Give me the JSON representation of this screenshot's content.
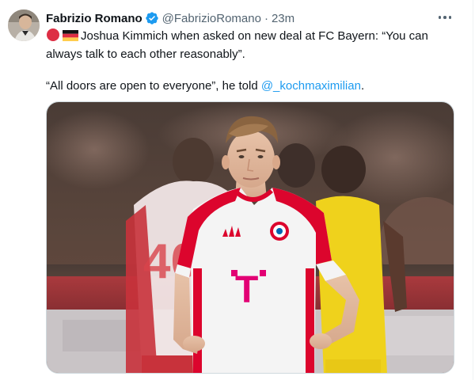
{
  "author": {
    "name": "Fabrizio Romano",
    "handle": "@FabrizioRomano",
    "separator": "·",
    "time": "23m",
    "verified": true
  },
  "tweet": {
    "line1": "Joshua Kimmich when asked on new deal at FC Bayern: “You can always talk to each other reasonably”.",
    "line2_prefix": "“All doors are open to everyone”, he told ",
    "mention": "@_kochmaximilian",
    "line2_suffix": ".",
    "emojis": [
      "red-circle-emoji",
      "germany-flag-emoji"
    ]
  },
  "media": {
    "alt_icons": [
      "football-player-photo"
    ],
    "colors": {
      "jersey_red": "#dc052d",
      "jersey_white": "#f4f4f4",
      "opponent_yellow": "#f2d400",
      "telekom_magenta": "#e20074"
    }
  },
  "colors": {
    "accent": "#1d9bf0",
    "muted": "#536471",
    "text": "#0f1419"
  }
}
